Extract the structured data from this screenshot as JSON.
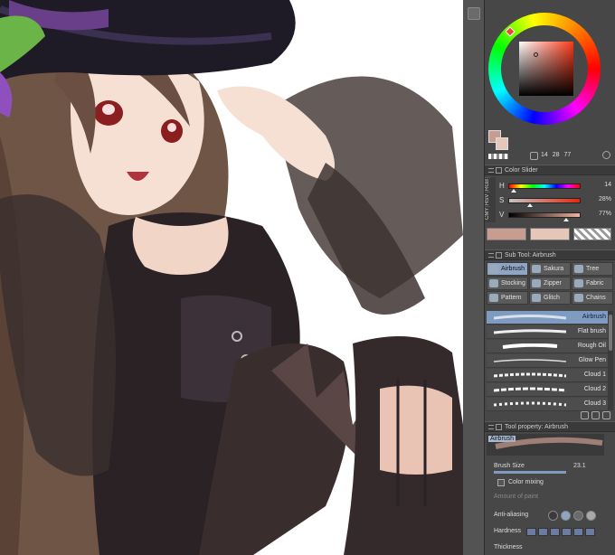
{
  "panels": {
    "color_slider": {
      "title": "Color Slider",
      "tabs": [
        "RGB",
        "HSV",
        "CMY"
      ],
      "rows": [
        {
          "label": "H",
          "value": "14"
        },
        {
          "label": "S",
          "value": "28%"
        },
        {
          "label": "V",
          "value": "77%"
        }
      ]
    },
    "color_wheel": {
      "readout": {
        "h": "14",
        "s": "28",
        "v": "77"
      },
      "main_color": "#c89d90",
      "sub_color": "#e6c6b8"
    },
    "sub_tool": {
      "title": "Sub Tool: Airbrush",
      "tools": [
        {
          "label": "Airbrush",
          "selected": true
        },
        {
          "label": "Sakura",
          "selected": false
        },
        {
          "label": "Tree",
          "selected": false
        },
        {
          "label": "Stocking",
          "selected": false
        },
        {
          "label": "Zipper",
          "selected": false
        },
        {
          "label": "Fabric",
          "selected": false
        },
        {
          "label": "Pattern",
          "selected": false
        },
        {
          "label": "Glitch",
          "selected": false
        },
        {
          "label": "Chains",
          "selected": false
        }
      ],
      "brushes": [
        {
          "name": "Airbrush",
          "selected": true
        },
        {
          "name": "Flat brush",
          "selected": false
        },
        {
          "name": "Rough Oil",
          "selected": false
        },
        {
          "name": "Glow Pen",
          "selected": false
        },
        {
          "name": "Cloud 1",
          "selected": false
        },
        {
          "name": "Cloud 2",
          "selected": false
        },
        {
          "name": "Cloud 3",
          "selected": false
        }
      ]
    },
    "tool_property": {
      "title": "Tool property: Airbrush",
      "preview_label": "Airbrush",
      "brush_size_label": "Brush Size",
      "brush_size_value": "23.1",
      "color_mixing_label": "Color mixing",
      "amount_of_paint_label": "Amount of paint",
      "anti_aliasing_label": "Anti-aliasing",
      "hardness_label": "Hardness",
      "thickness_label": "Thickness"
    }
  },
  "colors": {
    "accent_selected": "#8fa5c4",
    "panel_bg": "#474747"
  }
}
